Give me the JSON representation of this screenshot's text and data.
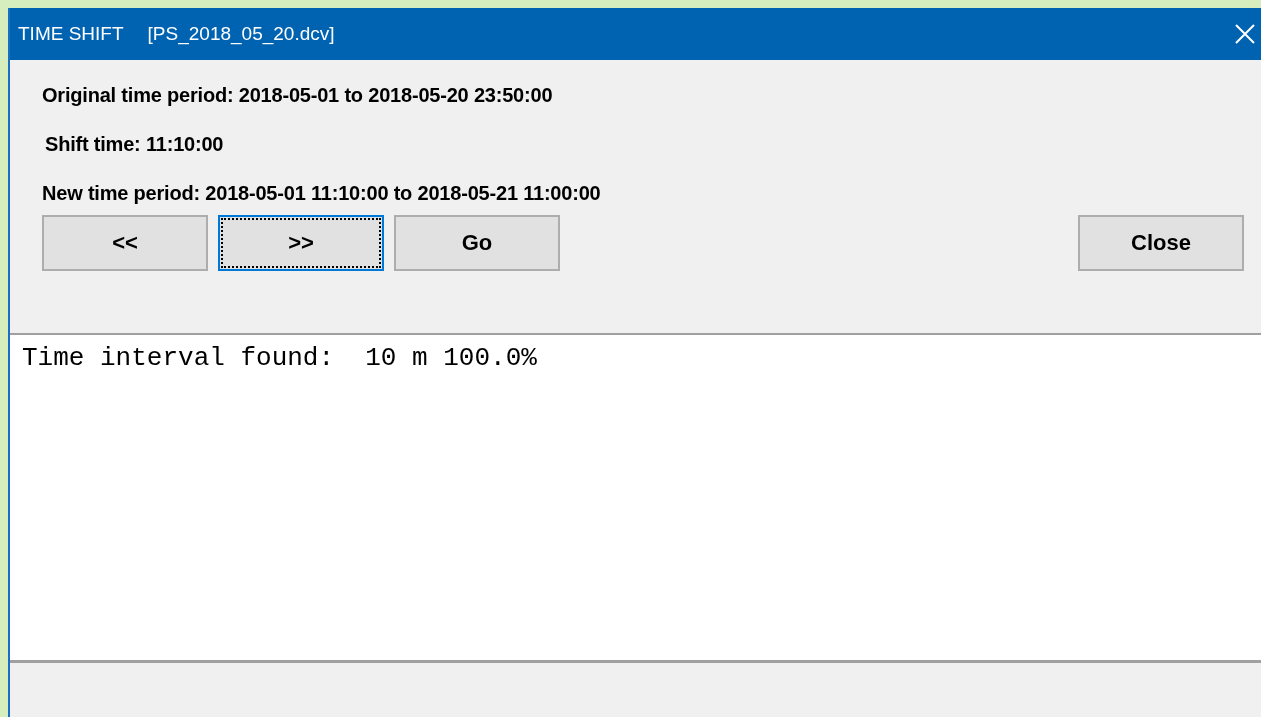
{
  "window": {
    "title": "TIME SHIFT",
    "file": "[PS_2018_05_20.dcv]"
  },
  "info_lines": [
    "Original time period: 2018-05-01 to 2018-05-20 23:50:00",
    "Shift time: 11:10:00",
    "New time period: 2018-05-01 11:10:00 to 2018-05-21 11:00:00"
  ],
  "buttons": [
    {
      "label": "<<",
      "focused": false
    },
    {
      "label": ">>",
      "focused": true
    },
    {
      "label": "Go",
      "focused": false
    }
  ],
  "close_button": {
    "label": "Close"
  },
  "output": {
    "text": "Time interval found:  10 m 100.0%"
  }
}
